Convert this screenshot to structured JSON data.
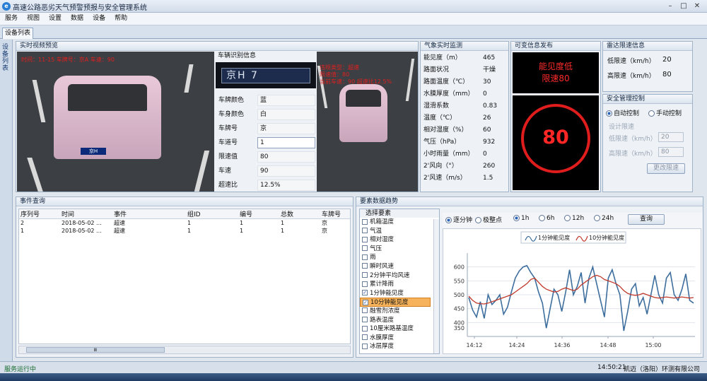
{
  "window": {
    "title": "高速公路恶劣天气预警预报与安全管理系统",
    "logo_char": "e"
  },
  "menu": [
    "服务",
    "视图",
    "设置",
    "数据",
    "设备",
    "帮助"
  ],
  "tab": "设备列表",
  "left_vertical_tab": "设备列表",
  "video": {
    "header": "实时视频预览",
    "overlay_line": "时间：11-15  车牌号：京A  车速：90",
    "overlay_small": [
      "违规类型：超速",
      "限速值：80",
      "当前车速：90  超速比12.5%"
    ],
    "plate_on_car": "京H"
  },
  "plate_panel": {
    "header": "车辆识别信息",
    "plate_image_text": "京H  7",
    "rows": [
      {
        "label": "车牌颜色",
        "value": "蓝"
      },
      {
        "label": "车身颜色",
        "value": "白"
      },
      {
        "label": "车牌号",
        "value": "京"
      },
      {
        "label": "车道号",
        "value": "1"
      },
      {
        "label": "限速值",
        "value": "80"
      },
      {
        "label": "车速",
        "value": "90"
      },
      {
        "label": "超速比",
        "value": "12.5%"
      }
    ]
  },
  "weather": {
    "header": "气象实时监测",
    "rows": [
      {
        "k": "能见度（m）",
        "v": "465"
      },
      {
        "k": "路面状况",
        "v": "干燥"
      },
      {
        "k": "路面温度（℃）",
        "v": "30"
      },
      {
        "k": "水膜厚度（mm）",
        "v": "0"
      },
      {
        "k": "湿滑系数",
        "v": "0.83"
      },
      {
        "k": "温度（℃）",
        "v": "26"
      },
      {
        "k": "相对湿度（%）",
        "v": "60"
      },
      {
        "k": "气压（hPa）",
        "v": "932"
      },
      {
        "k": "小时雨量（mm）",
        "v": "0"
      },
      {
        "k": "2'风向（°）",
        "v": "260"
      },
      {
        "k": "2'风速（m/s）",
        "v": "1.5"
      }
    ]
  },
  "vms": {
    "header": "可变信息发布",
    "line1": "能见度低",
    "line2": "限速80",
    "speed": "80"
  },
  "radar": {
    "header": "雷达限速信息",
    "low_label": "低限速（km/h）",
    "low_value": "20",
    "high_label": "高限速（km/h）",
    "high_value": "80"
  },
  "safety": {
    "header": "安全管理控制",
    "auto": "自动控制",
    "manual": "手动控制",
    "section": "设计限速",
    "low_label": "低限速（km/h）",
    "low_value": "20",
    "high_label": "高限速（km/h）",
    "high_value": "80",
    "button": "更改限速"
  },
  "events": {
    "header": "事件查询",
    "columns": [
      "序列号",
      "时间",
      "事件",
      "组ID",
      "编号",
      "总数",
      "车牌号"
    ],
    "rows": [
      [
        "2",
        "2018-05-02 ...",
        "超速",
        "1",
        "1",
        "1",
        "京"
      ],
      [
        "1",
        "2018-05-02 ...",
        "超速",
        "1",
        "1",
        "1",
        "京"
      ]
    ],
    "scroll_glyph": "Ⅲ"
  },
  "trend": {
    "header": "要素数据趋势",
    "select_label": "选择要素",
    "elements": [
      {
        "label": "机箱温度",
        "checked": false,
        "highlight": false
      },
      {
        "label": "气温",
        "checked": false,
        "highlight": false
      },
      {
        "label": "相对湿度",
        "checked": false,
        "highlight": false
      },
      {
        "label": "气压",
        "checked": false,
        "highlight": false
      },
      {
        "label": "雨",
        "checked": false,
        "highlight": false
      },
      {
        "label": "瞬时风速",
        "checked": false,
        "highlight": false
      },
      {
        "label": "2分钟平均风速",
        "checked": false,
        "highlight": false
      },
      {
        "label": "累计降雨",
        "checked": false,
        "highlight": false
      },
      {
        "label": "1分钟能见度",
        "checked": true,
        "highlight": false
      },
      {
        "label": "10分钟能见度",
        "checked": true,
        "highlight": true
      },
      {
        "label": "融雪剂浓度",
        "checked": false,
        "highlight": false
      },
      {
        "label": "路表温度",
        "checked": false,
        "highlight": false
      },
      {
        "label": "10厘米路基温度",
        "checked": false,
        "highlight": false
      },
      {
        "label": "水膜厚度",
        "checked": false,
        "highlight": false
      },
      {
        "label": "冰层厚度",
        "checked": false,
        "highlight": false
      }
    ],
    "mode_options": [
      "逐分钟",
      "极整点"
    ],
    "range_options": [
      "1h",
      "6h",
      "12h",
      "24h"
    ],
    "query_button": "查询",
    "colors": {
      "series1": "#3d6e9e",
      "series2": "#c0392b"
    }
  },
  "chart_data": {
    "type": "line",
    "legend": [
      "1分钟能见度",
      "10分钟能见度"
    ],
    "ylim": [
      350,
      650
    ],
    "yticks": [
      350,
      400,
      450,
      500,
      550,
      600
    ],
    "xticks": [
      "14:12",
      "14:24",
      "14:36",
      "14:48",
      "15:00"
    ],
    "x_minutes_range": [
      14.0,
      15.1
    ],
    "series": [
      {
        "name": "1分钟能见度",
        "values": [
          490,
          445,
          420,
          475,
          415,
          500,
          465,
          480,
          500,
          430,
          455,
          510,
          560,
          585,
          600,
          605,
          580,
          560,
          510,
          470,
          380,
          450,
          520,
          500,
          440,
          510,
          590,
          500,
          530,
          580,
          470,
          560,
          600,
          540,
          480,
          420,
          560,
          590,
          540,
          500,
          370,
          440,
          520,
          540,
          460,
          490,
          430,
          500,
          570,
          500,
          470,
          560,
          580,
          500,
          480,
          520,
          575,
          480,
          470
        ]
      },
      {
        "name": "10分钟能见度",
        "values": [
          495,
          480,
          470,
          468,
          467,
          470,
          475,
          480,
          485,
          490,
          495,
          500,
          510,
          520,
          530,
          540,
          555,
          560,
          545,
          530,
          520,
          515,
          510,
          512,
          520,
          525,
          520,
          515,
          520,
          535,
          545,
          555,
          565,
          570,
          565,
          555,
          550,
          545,
          540,
          530,
          515,
          505,
          500,
          498,
          500,
          505,
          500,
          495,
          490,
          488,
          490,
          492,
          490,
          488,
          490,
          492,
          490,
          488,
          490
        ]
      }
    ]
  },
  "status": {
    "left": "服务运行中",
    "time": "14:50:21",
    "company": "凯迈（洛阳）环测有限公司"
  }
}
